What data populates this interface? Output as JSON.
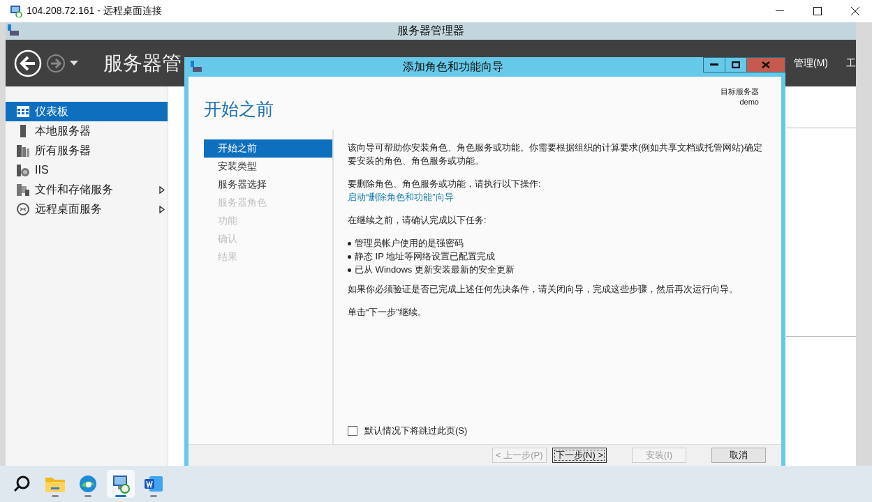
{
  "rdp_window": {
    "title": "104.208.72.161 - 远程桌面连接"
  },
  "server_manager": {
    "title": "服务器管理器",
    "header_title": "服务器管",
    "menu": [
      "管理(M)",
      "工"
    ],
    "sidebar": {
      "items": [
        {
          "label": "仪表板",
          "selected": true,
          "expandable": false
        },
        {
          "label": "本地服务器",
          "selected": false,
          "expandable": false
        },
        {
          "label": "所有服务器",
          "selected": false,
          "expandable": false
        },
        {
          "label": "IIS",
          "selected": false,
          "expandable": false
        },
        {
          "label": "文件和存储服务",
          "selected": false,
          "expandable": true
        },
        {
          "label": "远程桌面服务",
          "selected": false,
          "expandable": true
        }
      ]
    }
  },
  "wizard": {
    "title": "添加角色和功能向导",
    "heading": "开始之前",
    "target_label": "目标服务器",
    "target_value": "demo",
    "steps": [
      {
        "label": "开始之前",
        "selected": true,
        "disabled": false
      },
      {
        "label": "安装类型",
        "selected": false,
        "disabled": false
      },
      {
        "label": "服务器选择",
        "selected": false,
        "disabled": false
      },
      {
        "label": "服务器角色",
        "selected": false,
        "disabled": true
      },
      {
        "label": "功能",
        "selected": false,
        "disabled": true
      },
      {
        "label": "确认",
        "selected": false,
        "disabled": true
      },
      {
        "label": "结果",
        "selected": false,
        "disabled": true
      }
    ],
    "intro": "该向导可帮助你安装角色、角色服务或功能。你需要根据组织的计算要求(例如共享文档或托管网站)确定要安装的角色、角色服务或功能。",
    "remove_label": "要删除角色、角色服务或功能，请执行以下操作:",
    "remove_link": "启动“删除角色和功能”向导",
    "tasks_label": "在继续之前，请确认完成以下任务:",
    "tasks": [
      "管理员帐户使用的是强密码",
      "静态 IP 地址等网络设置已配置完成",
      "已从 Windows 更新安装最新的安全更新"
    ],
    "verify_note": "如果你必须验证是否已完成上述任何先决条件，请关闭向导，完成这些步骤，然后再次运行向导。",
    "next_note": "单击“下一步”继续。",
    "skip_checkbox": {
      "label": "默认情况下将跳过此页(S)",
      "checked": false
    },
    "buttons": [
      {
        "label": "< 上一步(P)",
        "disabled": true,
        "default": false
      },
      {
        "label": "下一步(N) >",
        "disabled": false,
        "default": true
      },
      {
        "label": "安装(I)",
        "disabled": true,
        "default": false
      },
      {
        "label": "取消",
        "disabled": false,
        "default": false
      }
    ]
  },
  "taskbar": {
    "apps": [
      {
        "kind": "search",
        "active": false
      },
      {
        "kind": "folder",
        "active": false
      },
      {
        "kind": "browser",
        "active": false
      },
      {
        "kind": "remote",
        "active": true
      },
      {
        "kind": "word",
        "active": false
      }
    ]
  }
}
